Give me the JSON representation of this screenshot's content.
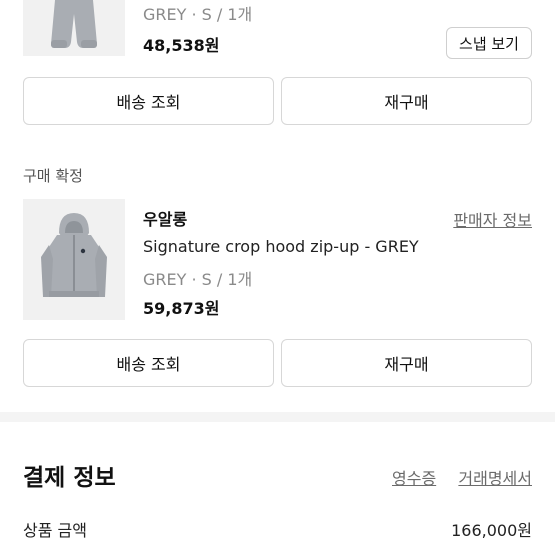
{
  "order1": {
    "option": "GREY · S / 1개",
    "price": "48,538원",
    "snap_button": "스냅 보기",
    "track_button": "배송 조회",
    "rebuy_button": "재구매"
  },
  "order2": {
    "status": "구매 확정",
    "shop": "우알롱",
    "seller_info": "판매자 정보",
    "name": "Signature crop hood zip-up - GREY",
    "option": "GREY · S / 1개",
    "price": "59,873원",
    "track_button": "배송 조회",
    "rebuy_button": "재구매"
  },
  "payment": {
    "title": "결제 정보",
    "receipt_link": "영수증",
    "statement_link": "거래명세서",
    "product_amount_label": "상품 금액",
    "product_amount_value": "166,000원"
  },
  "colors": {
    "text": "#111111",
    "muted": "#8a8a8a",
    "border": "#d7d7d7",
    "thumb_bg": "#f1f1f1",
    "garment": "#a9adb3"
  },
  "icons": [
    "pants-thumbnail",
    "hoodie-thumbnail"
  ]
}
